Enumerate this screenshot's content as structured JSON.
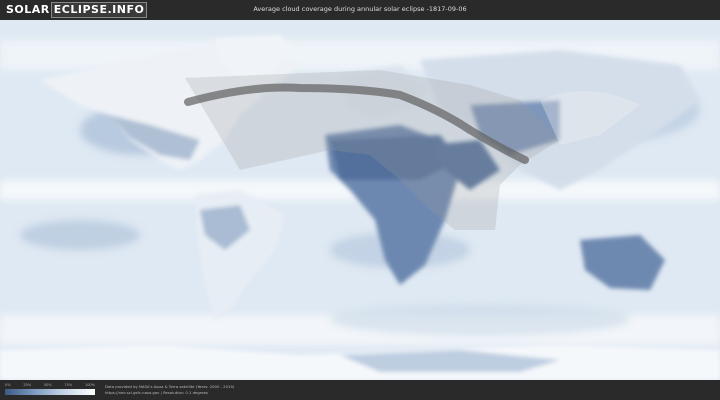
{
  "header": {
    "logo_part1": "SOLAR",
    "logo_part2": "ECLIPSE.INFO",
    "title": "Average cloud coverage during annular solar eclipse -1817-09-06"
  },
  "legend": {
    "ticks": [
      "0%",
      "25%",
      "50%",
      "75%",
      "100%"
    ],
    "colors": [
      "#3b5a86",
      "#7f9dc2",
      "#c6d6e8",
      "#ffffff"
    ]
  },
  "credits": {
    "line1": "Data provided by NASA's Aqua & Terra satellite (Years: 2000 - 2019)",
    "line2": "https://neo.sci.gsfc.nasa.gov  |  Resolution: 0.1 degrees"
  },
  "map": {
    "ocean_color": "#e6eef6",
    "land_cloudy_color": "#f2f5f9",
    "clear_color": "#5d7aa5",
    "eclipse_path_color": "#6b6b6b",
    "visibility_zone_color": "#bfbfbf"
  }
}
